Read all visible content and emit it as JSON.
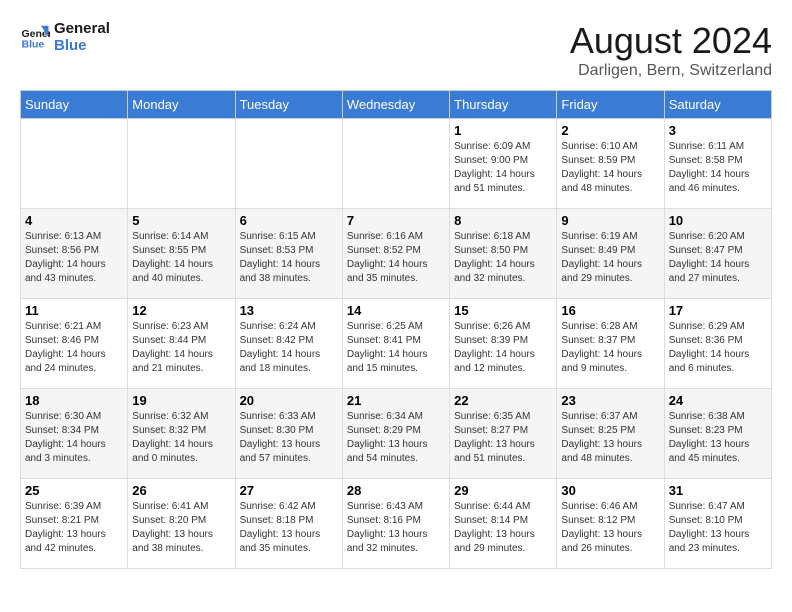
{
  "header": {
    "logo_line1": "General",
    "logo_line2": "Blue",
    "month_year": "August 2024",
    "location": "Darligen, Bern, Switzerland"
  },
  "weekdays": [
    "Sunday",
    "Monday",
    "Tuesday",
    "Wednesday",
    "Thursday",
    "Friday",
    "Saturday"
  ],
  "weeks": [
    [
      {
        "day": "",
        "info": ""
      },
      {
        "day": "",
        "info": ""
      },
      {
        "day": "",
        "info": ""
      },
      {
        "day": "",
        "info": ""
      },
      {
        "day": "1",
        "info": "Sunrise: 6:09 AM\nSunset: 9:00 PM\nDaylight: 14 hours\nand 51 minutes."
      },
      {
        "day": "2",
        "info": "Sunrise: 6:10 AM\nSunset: 8:59 PM\nDaylight: 14 hours\nand 48 minutes."
      },
      {
        "day": "3",
        "info": "Sunrise: 6:11 AM\nSunset: 8:58 PM\nDaylight: 14 hours\nand 46 minutes."
      }
    ],
    [
      {
        "day": "4",
        "info": "Sunrise: 6:13 AM\nSunset: 8:56 PM\nDaylight: 14 hours\nand 43 minutes."
      },
      {
        "day": "5",
        "info": "Sunrise: 6:14 AM\nSunset: 8:55 PM\nDaylight: 14 hours\nand 40 minutes."
      },
      {
        "day": "6",
        "info": "Sunrise: 6:15 AM\nSunset: 8:53 PM\nDaylight: 14 hours\nand 38 minutes."
      },
      {
        "day": "7",
        "info": "Sunrise: 6:16 AM\nSunset: 8:52 PM\nDaylight: 14 hours\nand 35 minutes."
      },
      {
        "day": "8",
        "info": "Sunrise: 6:18 AM\nSunset: 8:50 PM\nDaylight: 14 hours\nand 32 minutes."
      },
      {
        "day": "9",
        "info": "Sunrise: 6:19 AM\nSunset: 8:49 PM\nDaylight: 14 hours\nand 29 minutes."
      },
      {
        "day": "10",
        "info": "Sunrise: 6:20 AM\nSunset: 8:47 PM\nDaylight: 14 hours\nand 27 minutes."
      }
    ],
    [
      {
        "day": "11",
        "info": "Sunrise: 6:21 AM\nSunset: 8:46 PM\nDaylight: 14 hours\nand 24 minutes."
      },
      {
        "day": "12",
        "info": "Sunrise: 6:23 AM\nSunset: 8:44 PM\nDaylight: 14 hours\nand 21 minutes."
      },
      {
        "day": "13",
        "info": "Sunrise: 6:24 AM\nSunset: 8:42 PM\nDaylight: 14 hours\nand 18 minutes."
      },
      {
        "day": "14",
        "info": "Sunrise: 6:25 AM\nSunset: 8:41 PM\nDaylight: 14 hours\nand 15 minutes."
      },
      {
        "day": "15",
        "info": "Sunrise: 6:26 AM\nSunset: 8:39 PM\nDaylight: 14 hours\nand 12 minutes."
      },
      {
        "day": "16",
        "info": "Sunrise: 6:28 AM\nSunset: 8:37 PM\nDaylight: 14 hours\nand 9 minutes."
      },
      {
        "day": "17",
        "info": "Sunrise: 6:29 AM\nSunset: 8:36 PM\nDaylight: 14 hours\nand 6 minutes."
      }
    ],
    [
      {
        "day": "18",
        "info": "Sunrise: 6:30 AM\nSunset: 8:34 PM\nDaylight: 14 hours\nand 3 minutes."
      },
      {
        "day": "19",
        "info": "Sunrise: 6:32 AM\nSunset: 8:32 PM\nDaylight: 14 hours\nand 0 minutes."
      },
      {
        "day": "20",
        "info": "Sunrise: 6:33 AM\nSunset: 8:30 PM\nDaylight: 13 hours\nand 57 minutes."
      },
      {
        "day": "21",
        "info": "Sunrise: 6:34 AM\nSunset: 8:29 PM\nDaylight: 13 hours\nand 54 minutes."
      },
      {
        "day": "22",
        "info": "Sunrise: 6:35 AM\nSunset: 8:27 PM\nDaylight: 13 hours\nand 51 minutes."
      },
      {
        "day": "23",
        "info": "Sunrise: 6:37 AM\nSunset: 8:25 PM\nDaylight: 13 hours\nand 48 minutes."
      },
      {
        "day": "24",
        "info": "Sunrise: 6:38 AM\nSunset: 8:23 PM\nDaylight: 13 hours\nand 45 minutes."
      }
    ],
    [
      {
        "day": "25",
        "info": "Sunrise: 6:39 AM\nSunset: 8:21 PM\nDaylight: 13 hours\nand 42 minutes."
      },
      {
        "day": "26",
        "info": "Sunrise: 6:41 AM\nSunset: 8:20 PM\nDaylight: 13 hours\nand 38 minutes."
      },
      {
        "day": "27",
        "info": "Sunrise: 6:42 AM\nSunset: 8:18 PM\nDaylight: 13 hours\nand 35 minutes."
      },
      {
        "day": "28",
        "info": "Sunrise: 6:43 AM\nSunset: 8:16 PM\nDaylight: 13 hours\nand 32 minutes."
      },
      {
        "day": "29",
        "info": "Sunrise: 6:44 AM\nSunset: 8:14 PM\nDaylight: 13 hours\nand 29 minutes."
      },
      {
        "day": "30",
        "info": "Sunrise: 6:46 AM\nSunset: 8:12 PM\nDaylight: 13 hours\nand 26 minutes."
      },
      {
        "day": "31",
        "info": "Sunrise: 6:47 AM\nSunset: 8:10 PM\nDaylight: 13 hours\nand 23 minutes."
      }
    ]
  ]
}
